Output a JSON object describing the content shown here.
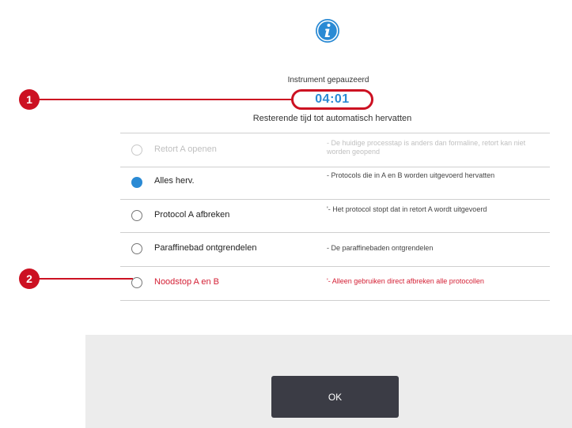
{
  "dialog": {
    "title": "Instrument gepauzeerd",
    "timer": "04:01",
    "subtitle": "Resterende tijd tot automatisch hervatten"
  },
  "options": [
    {
      "label": "Retort A openen",
      "description": "- De huidige processtap is anders dan formaline, retort kan niet worden geopend",
      "state": "disabled"
    },
    {
      "label": "Alles herv.",
      "description": "- Protocols die in A en B worden uitgevoerd hervatten",
      "state": "selected"
    },
    {
      "label": "Protocol A afbreken",
      "description": "'- Het protocol stopt dat in retort A wordt uitgevoerd",
      "state": "normal"
    },
    {
      "label": "Paraffinebad ontgrendelen",
      "description": "- De paraffinebaden ontgrendelen",
      "state": "normal"
    },
    {
      "label": "Noodstop A en B",
      "description": "'- Alleen gebruiken direct afbreken alle protocollen",
      "state": "danger"
    }
  ],
  "footer": {
    "ok_label": "OK"
  },
  "callouts": {
    "one": "1",
    "two": "2"
  },
  "colors": {
    "accent": "#2a8ad4",
    "callout": "#cc1122",
    "danger": "#d42035",
    "button": "#3b3c45"
  },
  "icons": {
    "info": "info-icon"
  }
}
